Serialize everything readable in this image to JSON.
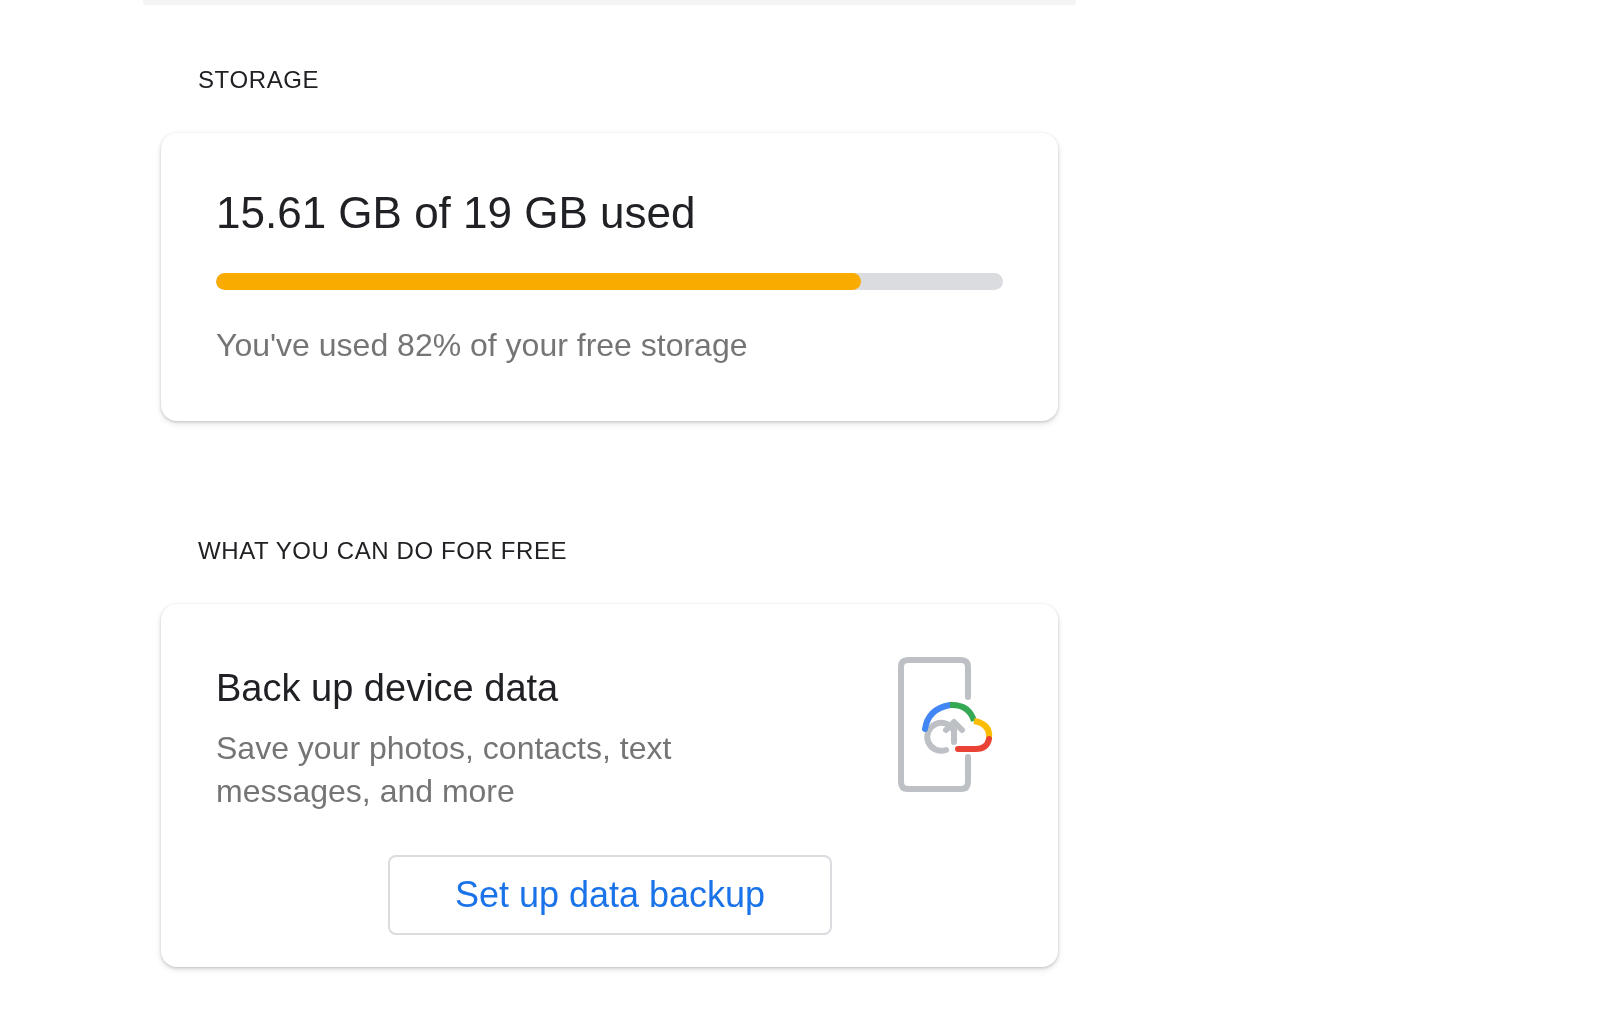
{
  "sections": [
    {
      "heading": "STORAGE",
      "card": {
        "kind": "usage",
        "title": "15.61 GB of 19 GB used",
        "level": 0.82,
        "caption": "You've used 82% of your free storage"
      }
    },
    {
      "heading": "WHAT YOU CAN DO FOR FREE",
      "card": {
        "kind": "action",
        "title": "Back up device data",
        "description": "Save your photos, contacts, text messages, and more",
        "button": "Set up data backup"
      }
    }
  ]
}
